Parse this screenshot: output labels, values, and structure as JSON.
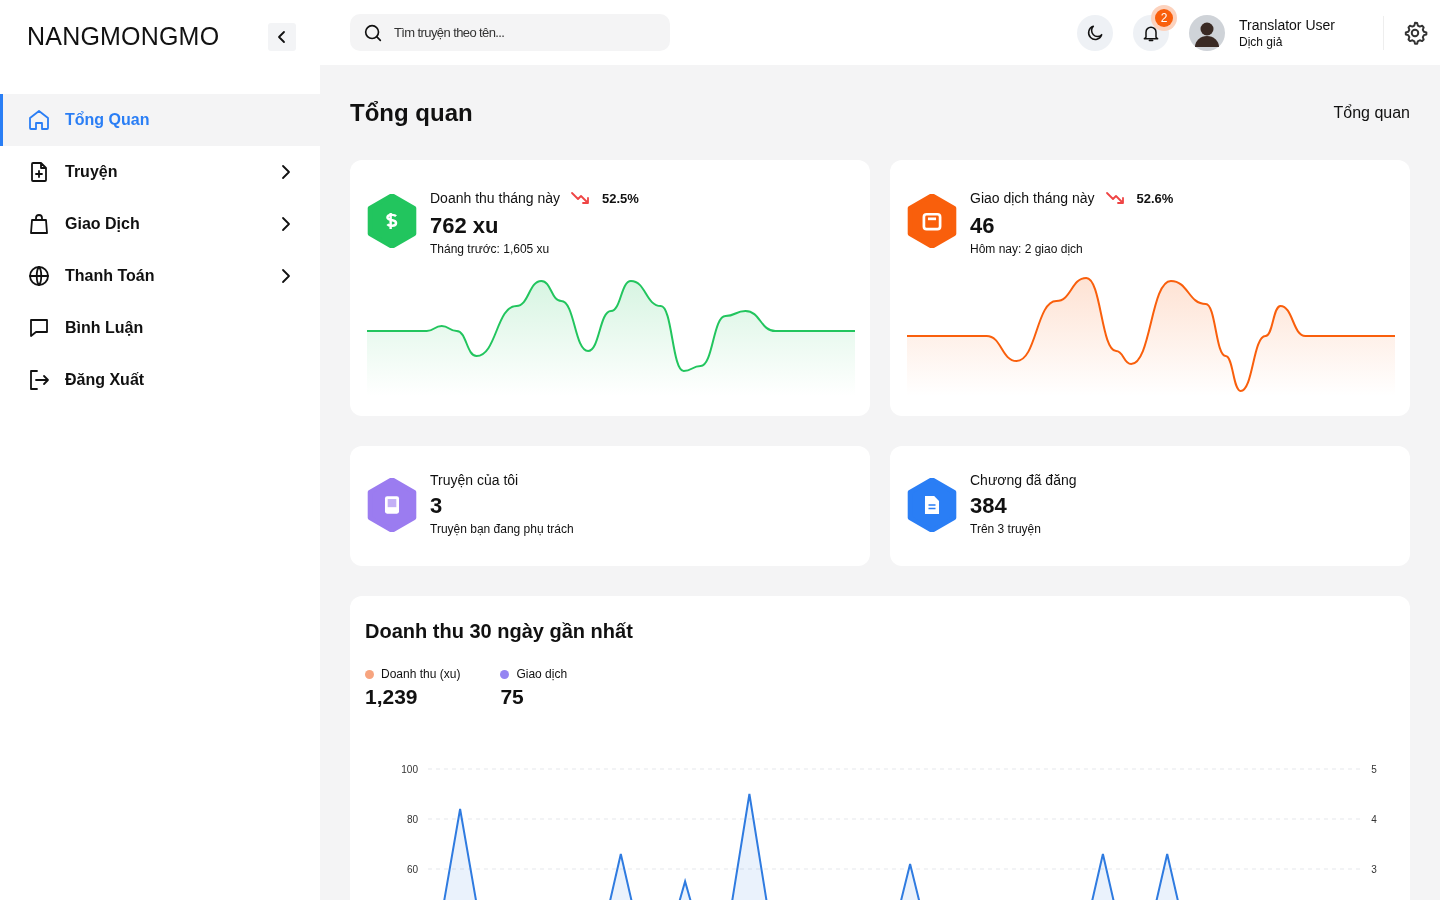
{
  "sidebar": {
    "logo": "NANGMONGMO",
    "items": [
      {
        "label": "Tổng Quan",
        "selected": true,
        "expandable": false
      },
      {
        "label": "Truyện",
        "selected": false,
        "expandable": true
      },
      {
        "label": "Giao Dịch",
        "selected": false,
        "expandable": true
      },
      {
        "label": "Thanh Toán",
        "selected": false,
        "expandable": true
      },
      {
        "label": "Bình Luận",
        "selected": false,
        "expandable": false
      },
      {
        "label": "Đăng Xuất",
        "selected": false,
        "expandable": false
      }
    ]
  },
  "header": {
    "search": {
      "placeholder": "Tìm truyện theo tên..."
    },
    "notifications": "2",
    "user": {
      "name": "Translator User",
      "role": "Dịch giả"
    }
  },
  "page": {
    "title": "Tổng quan",
    "breadcrumb": "Tổng quan"
  },
  "stats": [
    {
      "kind": "sparkline",
      "label": "Doanh thu tháng này",
      "change": "52.5%",
      "value": "762 xu",
      "note": "Tháng trước: 1,605 xu",
      "color": "#22c55e"
    },
    {
      "kind": "sparkline",
      "label": "Giao dịch tháng này",
      "change": "52.6%",
      "value": "46",
      "note": "Hôm nay: 2 giao dịch",
      "color": "#f95f0c"
    },
    {
      "kind": "plain",
      "label": "Truyện của tôi",
      "value": "3",
      "note": "Truyện bạn đang phụ trách",
      "color": "#9b7cf0"
    },
    {
      "kind": "plain",
      "label": "Chương đã đăng",
      "value": "384",
      "note": "Trên 3 truyện",
      "color": "#2a7ef5"
    }
  ],
  "revenue": {
    "title": "Doanh thu 30 ngày gần nhất",
    "legend": [
      {
        "label": "Doanh thu (xu)",
        "value": "1,239",
        "color": "#f7a47f"
      },
      {
        "label": "Giao dịch",
        "value": "75",
        "color": "#9585f2"
      }
    ],
    "chart_data": {
      "type": "area",
      "ylim": [
        0,
        100
      ],
      "yticks": [
        60,
        80,
        100
      ],
      "y2lim": [
        0,
        5
      ],
      "y2ticks": [
        3,
        4,
        5
      ],
      "series": [
        {
          "color": "#2f7be0",
          "values": [
            10,
            84,
            10,
            10,
            10,
            10,
            66,
            10,
            55,
            10,
            90,
            10,
            10,
            10,
            10,
            62,
            10,
            10,
            10,
            10,
            10,
            66,
            10,
            66,
            10,
            10,
            10,
            10,
            10,
            10
          ]
        }
      ]
    }
  }
}
